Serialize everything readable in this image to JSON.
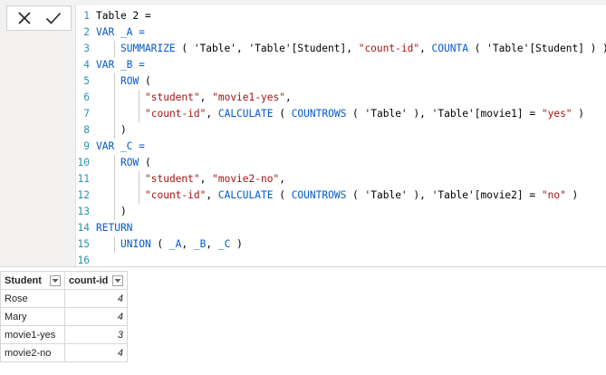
{
  "toolbar": {
    "cancel_icon": "close-icon",
    "commit_icon": "checkmark-icon"
  },
  "editor": {
    "lines": [
      {
        "num": "1",
        "indent": 0,
        "tokens": [
          {
            "t": "Table 2 =",
            "c": "plain"
          }
        ]
      },
      {
        "num": "2",
        "indent": 0,
        "tokens": [
          {
            "t": "VAR _A =",
            "c": "kw"
          }
        ]
      },
      {
        "num": "3",
        "indent": 1,
        "tokens": [
          {
            "t": "SUMMARIZE",
            "c": "kw"
          },
          {
            "t": " ( 'Table', 'Table'[Student], ",
            "c": "plain"
          },
          {
            "t": "\"count-id\"",
            "c": "str"
          },
          {
            "t": ", ",
            "c": "plain"
          },
          {
            "t": "COUNTA",
            "c": "kw"
          },
          {
            "t": " ( 'Table'[Student] ) )",
            "c": "plain"
          }
        ]
      },
      {
        "num": "4",
        "indent": 0,
        "tokens": [
          {
            "t": "VAR _B =",
            "c": "kw"
          }
        ]
      },
      {
        "num": "5",
        "indent": 1,
        "tokens": [
          {
            "t": "ROW",
            "c": "kw"
          },
          {
            "t": " (",
            "c": "plain"
          }
        ]
      },
      {
        "num": "6",
        "indent": 2,
        "tokens": [
          {
            "t": "\"student\"",
            "c": "str"
          },
          {
            "t": ", ",
            "c": "plain"
          },
          {
            "t": "\"movie1-yes\"",
            "c": "str"
          },
          {
            "t": ",",
            "c": "plain"
          }
        ]
      },
      {
        "num": "7",
        "indent": 2,
        "tokens": [
          {
            "t": "\"count-id\"",
            "c": "str"
          },
          {
            "t": ", ",
            "c": "plain"
          },
          {
            "t": "CALCULATE",
            "c": "kw"
          },
          {
            "t": " ( ",
            "c": "plain"
          },
          {
            "t": "COUNTROWS",
            "c": "kw"
          },
          {
            "t": " ( 'Table' ), 'Table'[movie1] = ",
            "c": "plain"
          },
          {
            "t": "\"yes\"",
            "c": "str"
          },
          {
            "t": " )",
            "c": "plain"
          }
        ]
      },
      {
        "num": "8",
        "indent": 1,
        "tokens": [
          {
            "t": ")",
            "c": "plain"
          }
        ]
      },
      {
        "num": "9",
        "indent": 0,
        "tokens": [
          {
            "t": "VAR _C =",
            "c": "kw"
          }
        ]
      },
      {
        "num": "10",
        "indent": 1,
        "tokens": [
          {
            "t": "ROW",
            "c": "kw"
          },
          {
            "t": " (",
            "c": "plain"
          }
        ]
      },
      {
        "num": "11",
        "indent": 2,
        "tokens": [
          {
            "t": "\"student\"",
            "c": "str"
          },
          {
            "t": ", ",
            "c": "plain"
          },
          {
            "t": "\"movie2-no\"",
            "c": "str"
          },
          {
            "t": ",",
            "c": "plain"
          }
        ]
      },
      {
        "num": "12",
        "indent": 2,
        "tokens": [
          {
            "t": "\"count-id\"",
            "c": "str"
          },
          {
            "t": ", ",
            "c": "plain"
          },
          {
            "t": "CALCULATE",
            "c": "kw"
          },
          {
            "t": " ( ",
            "c": "plain"
          },
          {
            "t": "COUNTROWS",
            "c": "kw"
          },
          {
            "t": " ( 'Table' ), 'Table'[movie2] = ",
            "c": "plain"
          },
          {
            "t": "\"no\"",
            "c": "str"
          },
          {
            "t": " )",
            "c": "plain"
          }
        ]
      },
      {
        "num": "13",
        "indent": 1,
        "tokens": [
          {
            "t": ")",
            "c": "plain"
          }
        ]
      },
      {
        "num": "14",
        "indent": 0,
        "tokens": [
          {
            "t": "RETURN",
            "c": "kw"
          }
        ]
      },
      {
        "num": "15",
        "indent": 1,
        "tokens": [
          {
            "t": "UNION",
            "c": "kw"
          },
          {
            "t": " ( ",
            "c": "plain"
          },
          {
            "t": "_A",
            "c": "kw"
          },
          {
            "t": ", ",
            "c": "plain"
          },
          {
            "t": "_B",
            "c": "kw"
          },
          {
            "t": ", ",
            "c": "plain"
          },
          {
            "t": "_C",
            "c": "kw"
          },
          {
            "t": " )",
            "c": "plain"
          }
        ]
      },
      {
        "num": "16",
        "indent": 0,
        "tokens": []
      }
    ]
  },
  "table": {
    "headers": [
      "Student",
      "count-id"
    ],
    "filter_icon": "chevron-down-icon",
    "rows": [
      {
        "student": "Rose",
        "count": "4"
      },
      {
        "student": "Mary",
        "count": "4"
      },
      {
        "student": "movie1-yes",
        "count": "3"
      },
      {
        "student": "movie2-no",
        "count": "4"
      }
    ]
  },
  "colors": {
    "keyword": "#035aca",
    "string": "#a31515",
    "line_number": "#2b91af"
  }
}
